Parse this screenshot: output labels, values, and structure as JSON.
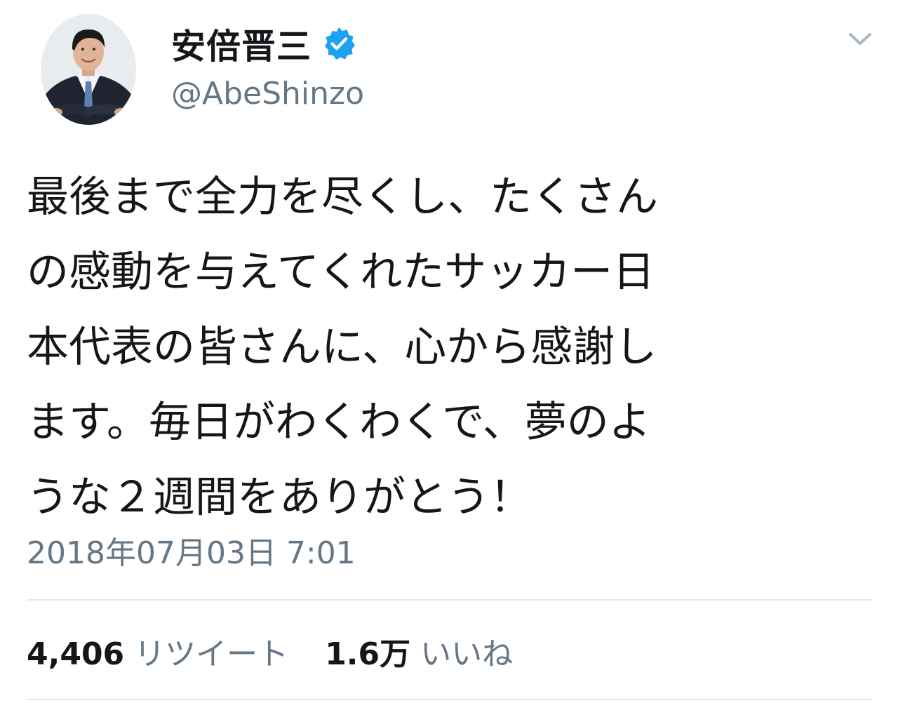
{
  "author": {
    "display_name": "安倍晋三",
    "handle": "@AbeShinzo",
    "verified": true,
    "avatar_icon": "profile-photo"
  },
  "tweet": {
    "lines": [
      "最後まで全力を尽くし、たくさん",
      "の感動を与えてくれたサッカー日",
      "本代表の皆さんに、心から感謝し",
      "ます。毎日がわくわくで、夢のよ",
      "うな２週間をありがとう！"
    ],
    "timestamp": "2018年07月03日 7:01"
  },
  "stats": {
    "retweets_count": "4,406",
    "retweets_label": "リツイート",
    "likes_count": "1.6万",
    "likes_label": "いいね"
  },
  "icons": {
    "verified": "verified-badge-icon",
    "menu": "chevron-down-icon"
  },
  "colors": {
    "text": "#14171a",
    "secondary": "#657786",
    "verified": "#1da1f2",
    "divider": "#e1e8ed",
    "background": "#ffffff"
  }
}
